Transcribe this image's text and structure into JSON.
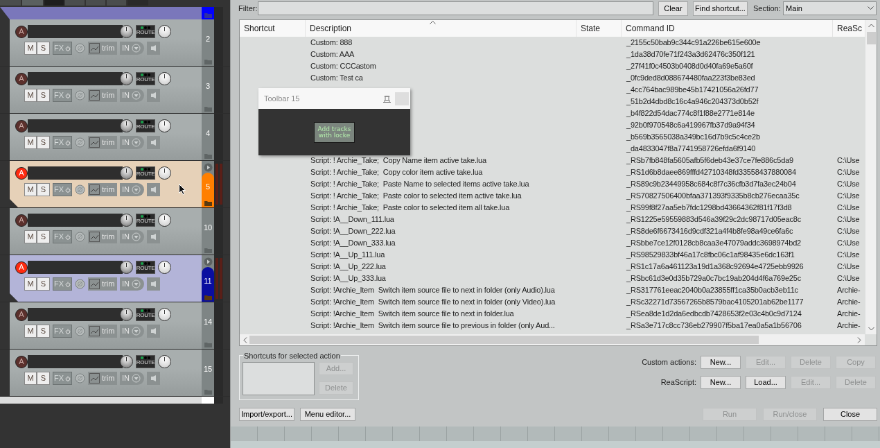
{
  "tracks": [
    {
      "kind": "folder_end",
      "color": "#7a77bb",
      "number_tab": {
        "color": "#0000ff"
      }
    },
    {
      "kind": "full",
      "number": "2",
      "selected": false,
      "armed": false,
      "arm": "A",
      "mute": "M",
      "solo": "S",
      "fx": "FX",
      "route": "ROUTE",
      "trim": "trim",
      "input": "IN"
    },
    {
      "kind": "full",
      "number": "3",
      "selected": false,
      "armed": false,
      "arm": "A",
      "mute": "M",
      "solo": "S",
      "fx": "FX",
      "route": "ROUTE",
      "trim": "trim",
      "input": "IN"
    },
    {
      "kind": "full",
      "number": "4",
      "selected": false,
      "armed": false,
      "arm": "A",
      "mute": "M",
      "solo": "S",
      "fx": "FX",
      "route": "ROUTE",
      "trim": "trim",
      "input": "IN"
    },
    {
      "kind": "full",
      "number": "5",
      "selected": true,
      "armed": true,
      "color": "#e6d1b8",
      "number_tab": {
        "color": "#ff7f00"
      },
      "arm": "A",
      "mute": "M",
      "solo": "S",
      "fx": "FX",
      "route": "ROUTE",
      "trim": "trim",
      "input": "IN"
    },
    {
      "kind": "full",
      "number": "10",
      "selected": false,
      "armed": false,
      "arm": "A",
      "mute": "M",
      "solo": "S",
      "fx": "FX",
      "route": "ROUTE",
      "trim": "trim",
      "input": "IN"
    },
    {
      "kind": "full",
      "number": "11",
      "selected": true,
      "armed": true,
      "color": "#b3b4d8",
      "number_tab": {
        "color": "#0a0ea0"
      },
      "arm": "A",
      "mute": "M",
      "solo": "S",
      "fx": "FX",
      "route": "ROUTE",
      "trim": "trim",
      "input": "IN"
    },
    {
      "kind": "full",
      "number": "14",
      "selected": false,
      "armed": false,
      "arm": "A",
      "mute": "M",
      "solo": "S",
      "fx": "FX",
      "route": "ROUTE",
      "trim": "trim",
      "input": "IN"
    },
    {
      "kind": "full",
      "number": "15",
      "selected": false,
      "armed": false,
      "arm": "A",
      "mute": "M",
      "solo": "S",
      "fx": "FX",
      "route": "ROUTE",
      "trim": "trim",
      "input": "IN"
    },
    {
      "kind": "partial"
    }
  ],
  "actions": {
    "filter": {
      "label": "Filter:"
    },
    "clear_button": "Clear",
    "find_button": "Find shortcut...",
    "section": {
      "label": "Section:",
      "value": "Main"
    },
    "columns": [
      "Shortcut",
      "Description",
      "State",
      "Command ID",
      "ReaSc"
    ],
    "rows": [
      {
        "description": "Custom: 888",
        "command_id": "_2155c50bab9c344c91a226be615e600e"
      },
      {
        "description": "Custom: AAA",
        "command_id": "_1da38d70fe71f243a3d62476c350f121"
      },
      {
        "description": "Custom: CCCastom",
        "command_id": "_27f41f0c4503b0408d0d40fa69e5a60f"
      },
      {
        "description": "Custom: Test ca",
        "command_id": "_0fc9ded8d088674480faa223f3be83ed"
      },
      {
        "command_id": "_4cc764bac989be45b17421056a26fd77"
      },
      {
        "command_id": "_51b2d4dbd8c16c4a946c204373d0b52f"
      },
      {
        "command_id": "_b4f822d54dac774c8f1f88e2771e814e"
      },
      {
        "command_id": "_92b0f970548c6a419967fb37d9a94f34"
      },
      {
        "command_id": "_b569b3565038a349bc16d7b9c5c4ce2b"
      },
      {
        "command_id": "_da4833047f8a7741958726efda6f9140"
      },
      {
        "description": "Script: ! Archie_Take;  Copy Name item active take.lua",
        "command_id": "_RSb7fb848fa5605afb5f6deb43e37ce7fe886c5da9",
        "path": "C:\\Use"
      },
      {
        "description": "Script: ! Archie_Take;  Copy color item active take.lua",
        "command_id": "_RS1d6b8daee869fffd42710348fd33558437880084",
        "path": "C:\\Use"
      },
      {
        "description": "Script: ! Archie_Take;  Paste Name to selected items active take.lua",
        "command_id": "_RS89c9b23449958c684c8f7c36cfb3d7fa3ec24b04",
        "path": "C:\\Use"
      },
      {
        "description": "Script: ! Archie_Take;  Paste color to selected item active take.lua",
        "command_id": "_RS70827506400bfaa371393f9335b8cb276ecaa35c",
        "path": "C:\\Use"
      },
      {
        "description": "Script: ! Archie_Take;  Paste color to selected item all take.lua",
        "command_id": "_RS99f8f27aa5eb7fdc1298bd43664362f81f17f3d8",
        "path": "C:\\Use"
      },
      {
        "description": "Script: !A__Down_111.lua",
        "command_id": "_RS1225e59559883d546a39f29c2dc98717d05eac8c",
        "path": "C:\\Use"
      },
      {
        "description": "Script: !A__Down_222.lua",
        "command_id": "_RS8de6f6673416d9cdf321a4f4b8fe98a49ce6fa6c",
        "path": "C:\\Use"
      },
      {
        "description": "Script: !A__Down_333.lua",
        "command_id": "_RSbbe7ce12f0128cb8caa3e47079addc3698974bd2",
        "path": "C:\\Use"
      },
      {
        "description": "Script: !A__Up_111.lua",
        "command_id": "_RS98529833bf46a17c8fbc06c1af98435e6dc163f1",
        "path": "C:\\Use"
      },
      {
        "description": "Script: !A__Up_222.lua",
        "command_id": "_RS1c17a6a461123a19d1a368c92694e4725ebb9926",
        "path": "C:\\Use"
      },
      {
        "description": "Script: !A__Up_333.lua",
        "command_id": "_RSbc61d3e0d35b729a0c7bc19ab204d4f6a769e25c",
        "path": "C:\\Use"
      },
      {
        "description": "Script: !Archie_Item  Switch item source file to next in folder (only Audio).lua",
        "command_id": "_RS317761eeac2040b0a23855ff1ca35b0acb3eb11c",
        "path": "Archie-"
      },
      {
        "description": "Script: !Archie_Item  Switch item source file to next in folder (only Video).lua",
        "command_id": "_RSc32271d73567265b8579bac4105201ab62be1177",
        "path": "Archie-"
      },
      {
        "description": "Script: !Archie_Item  Switch item source file to next in folder.lua",
        "command_id": "_RSea8de1d2da6edbcdb7428653f2e03c4b0c9d7124",
        "path": "Archie-"
      },
      {
        "description": "Script: !Archie_Item  Switch item source file to previous in folder (only Aud...",
        "command_id": "_RSa3e717c8cc736eb279907f5ba17ea0a5a1b56706",
        "path": "Archie-"
      }
    ],
    "shortcuts_group": {
      "title": "Shortcuts for selected action",
      "buttons": [
        {
          "label": "Add...",
          "disabled": true
        },
        {
          "label": "Delete",
          "disabled": true
        }
      ]
    },
    "button_rows": [
      {
        "label": "Custom actions:",
        "buttons": [
          {
            "label": "New...",
            "disabled": false
          },
          {
            "label": "Edit...",
            "disabled": true
          },
          {
            "label": "Delete",
            "disabled": true
          },
          {
            "label": "Copy",
            "disabled": true
          }
        ]
      },
      {
        "label": "ReaScript:",
        "buttons": [
          {
            "label": "New...",
            "disabled": false
          },
          {
            "label": "Load...",
            "disabled": false
          },
          {
            "label": "Edit...",
            "disabled": true
          },
          {
            "label": "Delete",
            "disabled": true
          }
        ]
      }
    ],
    "left_buttons": [
      {
        "label": "Import/export...",
        "disabled": false
      },
      {
        "label": "Menu editor...",
        "disabled": false
      }
    ],
    "run_buttons": [
      {
        "label": "Run",
        "disabled": true
      },
      {
        "label": "Run/close",
        "disabled": true
      },
      {
        "label": "Close",
        "disabled": false
      }
    ]
  },
  "toolbar_window": {
    "title": "Toolbar 15",
    "button": "Add tracks with locke"
  }
}
